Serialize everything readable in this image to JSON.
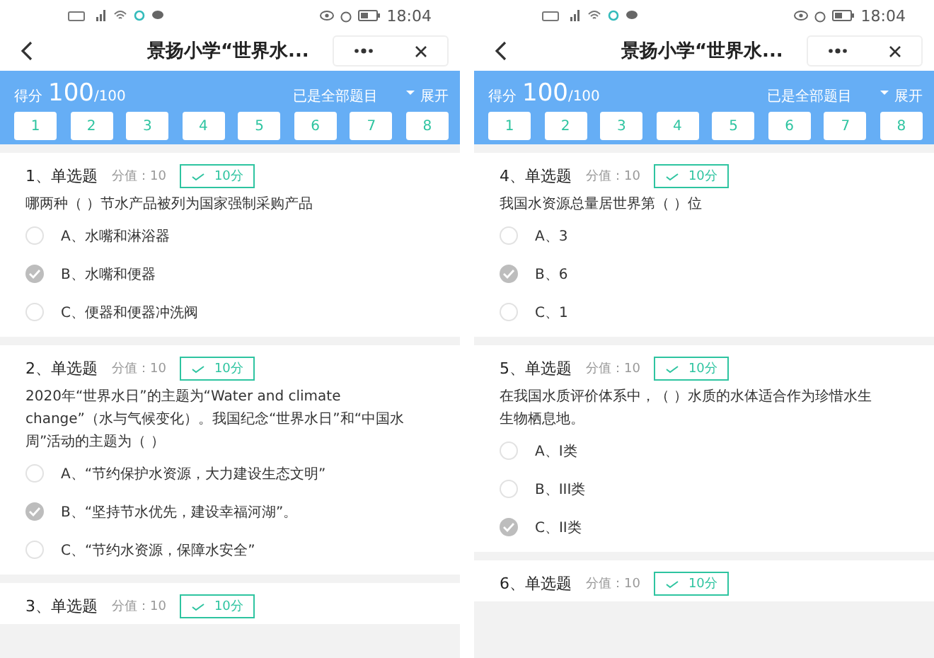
{
  "screens": [
    {
      "status_bar": {
        "time": "18:04"
      },
      "title": "景扬小学“世界水...",
      "score_label": "得分",
      "score": "100",
      "score_total": "/100",
      "filter": "已是全部题目",
      "expand": "展开",
      "question_numbers": [
        "1",
        "2",
        "3",
        "4",
        "5",
        "6",
        "7",
        "8"
      ],
      "questions": [
        {
          "heading": "1、单选题",
          "points": "分值：10",
          "result": "10分",
          "text": "哪两种（ ）节水产品被列为国家强制采购产品",
          "options": [
            {
              "label": "A、水嘴和淋浴器",
              "selected": false
            },
            {
              "label": "B、水嘴和便器",
              "selected": true
            },
            {
              "label": "C、便器和便器冲洗阀",
              "selected": false
            }
          ]
        },
        {
          "heading": "2、单选题",
          "points": "分值：10",
          "result": "10分",
          "text": "2020年“世界水日”的主题为“Water and climate change”（水与气候变化）。我国纪念“世界水日”和“中国水周”活动的主题为（ ）",
          "options": [
            {
              "label": "A、“节约保护水资源，大力建设生态文明”",
              "selected": false
            },
            {
              "label": "B、“坚持节水优先，建设幸福河湖”。",
              "selected": true
            },
            {
              "label": "C、“节约水资源，保障水安全”",
              "selected": false
            }
          ]
        },
        {
          "heading": "3、单选题",
          "points": "分值：10",
          "result": "10分"
        }
      ]
    },
    {
      "status_bar": {
        "time": "18:04"
      },
      "title": "景扬小学“世界水...",
      "score_label": "得分",
      "score": "100",
      "score_total": "/100",
      "filter": "已是全部题目",
      "expand": "展开",
      "question_numbers": [
        "1",
        "2",
        "3",
        "4",
        "5",
        "6",
        "7",
        "8"
      ],
      "questions": [
        {
          "heading": "4、单选题",
          "points": "分值：10",
          "result": "10分",
          "text": "我国水资源总量居世界第（ ）位",
          "options": [
            {
              "label": "A、3",
              "selected": false
            },
            {
              "label": "B、6",
              "selected": true
            },
            {
              "label": "C、1",
              "selected": false
            }
          ]
        },
        {
          "heading": "5、单选题",
          "points": "分值：10",
          "result": "10分",
          "text": "在我国水质评价体系中，（ ）水质的水体适合作为珍惜水生生物栖息地。",
          "options": [
            {
              "label": "A、I类",
              "selected": false
            },
            {
              "label": "B、III类",
              "selected": false
            },
            {
              "label": "C、II类",
              "selected": true
            }
          ]
        },
        {
          "heading": "6、单选题",
          "points": "分值：10",
          "result": "10分"
        }
      ]
    }
  ]
}
